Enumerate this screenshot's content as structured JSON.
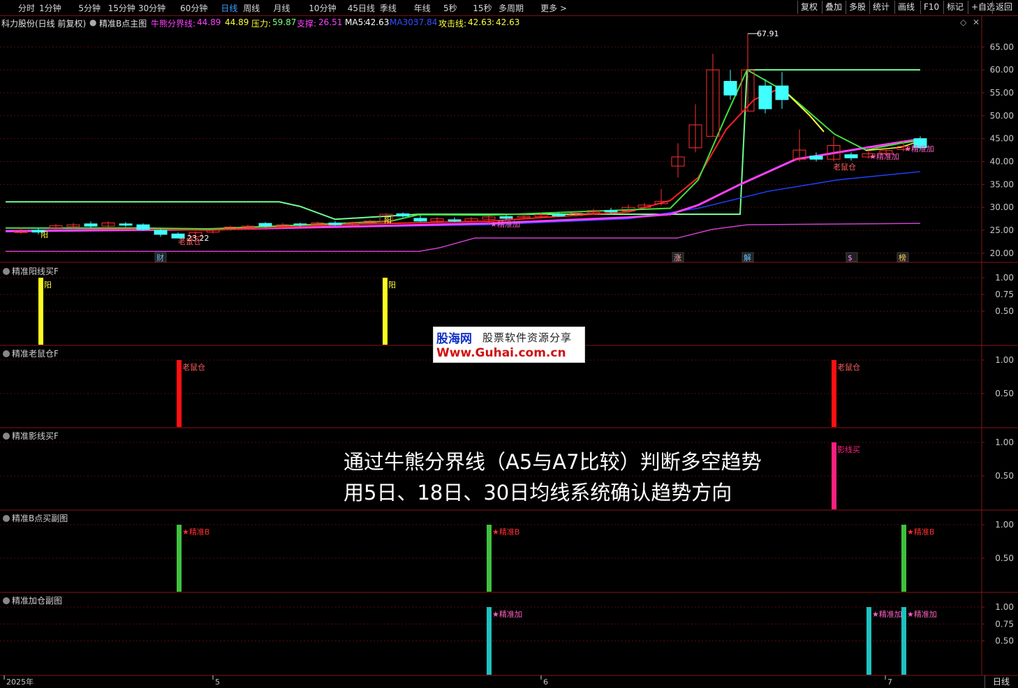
{
  "toolbar": {
    "periods": [
      "分时",
      "1分钟",
      "5分钟",
      "15分钟",
      "30分钟",
      "60分钟",
      "日线",
      "周线",
      "月线",
      "10分钟",
      "45日线",
      "季线",
      "年线",
      "5秒",
      "15秒",
      "多周期",
      "更多 >"
    ],
    "active_period": "日线",
    "buttons": [
      "复权",
      "叠加",
      "多股",
      "统计",
      "画线",
      "F10",
      "标记",
      "+自选",
      "返回"
    ]
  },
  "title": {
    "stock": "科力股份(日线 前复权)",
    "indicator": "精准B点主图",
    "bull_bear_label": "牛熊分界线:",
    "bull_bear_value1": "44.89",
    "bull_bear_value2": "44.89",
    "pressure_label": "压力:",
    "pressure_value": "59.87",
    "support_label": "支撑:",
    "support_value": "26.51",
    "ma5_label": "MA5:",
    "ma5_value": "42.63",
    "ma30_label": "MA30:",
    "ma30_value": "37.84",
    "attack_label": "攻击线:",
    "attack_value1": "42.63",
    "attack_value2": "42.63"
  },
  "main_chart": {
    "y_ticks": [
      "65.00",
      "60.00",
      "55.00",
      "50.00",
      "45.00",
      "40.00",
      "35.00",
      "30.00",
      "25.00",
      "20.00"
    ],
    "peak_label": "67.91",
    "low_label": "23.22",
    "event_labels": [
      "财",
      "涨",
      "解",
      "$",
      "榜"
    ],
    "signal_labels": {
      "yang": "阳",
      "mouse": "老鼠仓",
      "jzj": "★精准加"
    }
  },
  "chart_data": {
    "type": "candlestick",
    "ylim": [
      18,
      69
    ],
    "x_labels": [
      "2025年",
      "5",
      "6",
      "7"
    ],
    "series": [
      {
        "name": "牛熊分界线"
      },
      {
        "name": "压力"
      },
      {
        "name": "支撑"
      },
      {
        "name": "MA5"
      },
      {
        "name": "MA30"
      },
      {
        "name": "攻击线"
      }
    ],
    "candles_sample": [
      {
        "open": 39.0,
        "close": 41.0,
        "high": 44.0,
        "low": 36.5
      },
      {
        "open": 43.0,
        "close": 48.0,
        "high": 52.5,
        "low": 42.0
      },
      {
        "open": 45.5,
        "close": 60.0,
        "high": 63.5,
        "low": 45.5
      },
      {
        "open": 57.5,
        "close": 54.5,
        "high": 60.0,
        "low": 53.5
      },
      {
        "open": 51.0,
        "close": 60.0,
        "high": 67.91,
        "low": 51.0
      },
      {
        "open": 56.5,
        "close": 51.5,
        "high": 58.0,
        "low": 50.5
      },
      {
        "open": 56.5,
        "close": 53.5,
        "high": 59.5,
        "low": 51.5
      },
      {
        "open": 40.5,
        "close": 42.5,
        "high": 47.0,
        "low": 40.0
      },
      {
        "open": 40.5,
        "close": 43.5,
        "high": 45.5,
        "low": 40.0
      },
      {
        "open": 45.0,
        "close": 43.0,
        "high": 45.5,
        "low": 42.5
      }
    ]
  },
  "panels": [
    {
      "title": "精准阳线买F",
      "ticks": [
        "1.00",
        "0.75",
        "0.50"
      ],
      "signal": "阳"
    },
    {
      "title": "精准老鼠仓F",
      "ticks": [
        "1.00",
        "0.50"
      ],
      "signal": "老鼠仓"
    },
    {
      "title": "精准影线买F",
      "ticks": [
        "1.00",
        "0.50"
      ],
      "signal": "影线买"
    },
    {
      "title": "精准B点买副图",
      "ticks": [
        "1.00",
        "0.50"
      ],
      "signal": "★精准B"
    },
    {
      "title": "精准加仓副图",
      "ticks": [
        "1.00",
        "0.75",
        "0.50"
      ],
      "signal": "★精准加"
    }
  ],
  "bottom_label": "日线",
  "overlay": {
    "line1": "通过牛熊分界线（A5与A7比较）判断多空趋势",
    "line2": "用5日、18日、30日均线系统确认趋势方向"
  },
  "watermark": {
    "brand": "股海网",
    "slogan": "股票软件资源分享",
    "url": "Www.Guhai.com.cn"
  },
  "colors": {
    "bull_bear": "#ff40ff",
    "pressure": "#80ff80",
    "support": "#ff40ff",
    "ma5": "#ffffff",
    "ma30": "#2040ff",
    "attack": "#ffff00",
    "up_candle": "#ff4040",
    "down_candle": "#40ffff",
    "grid": "#5a0a0a"
  }
}
